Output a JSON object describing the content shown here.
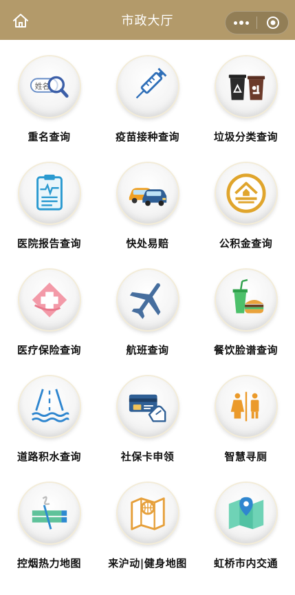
{
  "header": {
    "title": "市政大厅"
  },
  "services": [
    {
      "label": "重名查询",
      "icon": "name-search-icon"
    },
    {
      "label": "疫苗接种查询",
      "icon": "syringe-icon"
    },
    {
      "label": "垃圾分类查询",
      "icon": "trash-bins-icon"
    },
    {
      "label": "医院报告查询",
      "icon": "medical-report-icon"
    },
    {
      "label": "快处易赔",
      "icon": "cars-icon"
    },
    {
      "label": "公积金查询",
      "icon": "house-fund-icon"
    },
    {
      "label": "医疗保险查询",
      "icon": "medical-cross-icon"
    },
    {
      "label": "航班查询",
      "icon": "airplane-icon"
    },
    {
      "label": "餐饮脸谱查询",
      "icon": "food-drink-icon"
    },
    {
      "label": "道路积水查询",
      "icon": "road-water-icon"
    },
    {
      "label": "社保卡申领",
      "icon": "social-card-icon"
    },
    {
      "label": "智慧寻厕",
      "icon": "restroom-icon"
    },
    {
      "label": "控烟热力地图",
      "icon": "no-smoking-icon"
    },
    {
      "label": "来沪动|健身地图",
      "icon": "fitness-map-icon"
    },
    {
      "label": "虹桥市内交通",
      "icon": "transit-map-icon"
    }
  ],
  "icon_text": {
    "name_tag": "姓名"
  },
  "colors": {
    "header_bg": "#b39a6a",
    "gold": "#e0a52c",
    "blue": "#3a8fd0",
    "navy": "#2f5f95"
  }
}
